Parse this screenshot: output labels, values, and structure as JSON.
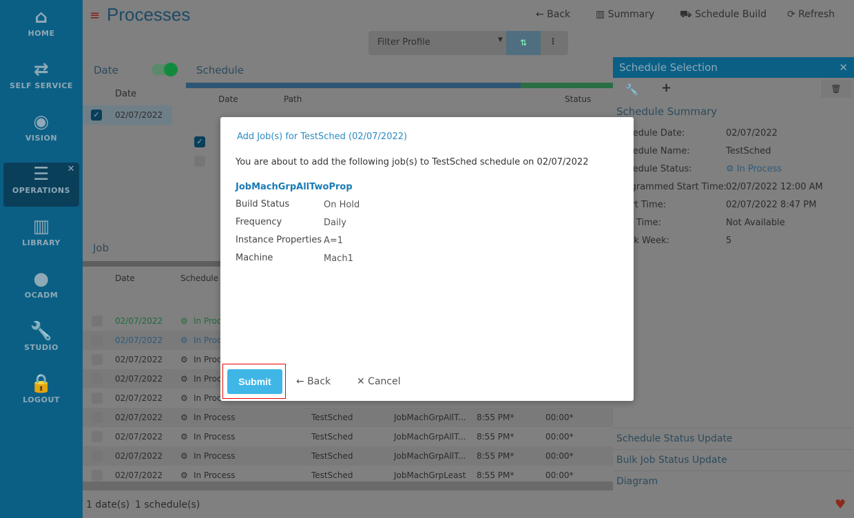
{
  "sidebar": {
    "items": [
      {
        "label": "HOME",
        "icon": "home-icon",
        "glyph": "⌂"
      },
      {
        "label": "SELF SERVICE",
        "icon": "exchange-icon",
        "glyph": "⇄"
      },
      {
        "label": "VISION",
        "icon": "eye-icon",
        "glyph": "◉"
      },
      {
        "label": "OPERATIONS",
        "icon": "tasks-icon",
        "glyph": "☰",
        "active": true
      },
      {
        "label": "LIBRARY",
        "icon": "books-icon",
        "glyph": "▥"
      },
      {
        "label": "OCADM",
        "icon": "user-icon",
        "glyph": "●"
      },
      {
        "label": "STUDIO",
        "icon": "wrench-icon",
        "glyph": "🔧"
      },
      {
        "label": "LOGOUT",
        "icon": "lock-icon",
        "glyph": "🔒"
      }
    ]
  },
  "header": {
    "title": "Processes",
    "back": "← Back",
    "summary": "▥ Summary",
    "schedule_build": "⛟ Schedule Build",
    "refresh": "⟳ Refresh"
  },
  "filter": {
    "placeholder": "Filter Profile"
  },
  "date_pane": {
    "title": "Date",
    "col": "Date",
    "rows": [
      "02/07/2022"
    ]
  },
  "schedule_pane": {
    "title": "Schedule",
    "cols": [
      "Date",
      "Path",
      "Status"
    ]
  },
  "job_pane": {
    "title": "Job",
    "cols": [
      "Date",
      "Schedule S"
    ],
    "rows": [
      {
        "date": "02/07/2022",
        "status": "In Proc",
        "sched": "",
        "job": "",
        "start": "",
        "dur": ""
      },
      {
        "date": "02/07/2022",
        "status": "In Proc",
        "sched": "",
        "job": "",
        "start": "",
        "dur": ""
      },
      {
        "date": "02/07/2022",
        "status": "In Proc",
        "sched": "",
        "job": "",
        "start": "",
        "dur": ""
      },
      {
        "date": "02/07/2022",
        "status": "In Proc",
        "sched": "",
        "job": "",
        "start": "",
        "dur": ""
      },
      {
        "date": "02/07/2022",
        "status": "In Proc",
        "sched": "",
        "job": "",
        "start": "",
        "dur": ""
      },
      {
        "date": "02/07/2022",
        "status": "In Process",
        "sched": "TestSched",
        "job": "JobMachGrpAllT...",
        "start": "8:55 PM*",
        "dur": "00:00*"
      },
      {
        "date": "02/07/2022",
        "status": "In Process",
        "sched": "TestSched",
        "job": "JobMachGrpAllT...",
        "start": "8:55 PM*",
        "dur": "00:00*"
      },
      {
        "date": "02/07/2022",
        "status": "In Process",
        "sched": "TestSched",
        "job": "JobMachGrpAllT...",
        "start": "8:55 PM*",
        "dur": "00:00*"
      },
      {
        "date": "02/07/2022",
        "status": "In Process",
        "sched": "TestSched",
        "job": "JobMachGrpLeast",
        "start": "8:55 PM*",
        "dur": "00:00*"
      }
    ]
  },
  "footer": {
    "dates": "1 date(s)",
    "schedules": "1 schedule(s)"
  },
  "right_panel": {
    "title": "Schedule Selection",
    "summary_title": "Schedule Summary",
    "fields": [
      {
        "label": "Schedule Date:",
        "value": "02/07/2022"
      },
      {
        "label": "Schedule Name:",
        "value": "TestSched"
      },
      {
        "label": "Schedule Status:",
        "value": "In Process"
      },
      {
        "label": "Programmed Start Time:",
        "value": "02/07/2022 12:00 AM"
      },
      {
        "label": "Start Time:",
        "value": "02/07/2022 8:47 PM"
      },
      {
        "label": "End Time:",
        "value": "Not Available"
      },
      {
        "label": "Work Week:",
        "value": "5"
      }
    ],
    "sections": [
      "Schedule Status Update",
      "Bulk Job Status Update",
      "Diagram"
    ]
  },
  "modal": {
    "title": "Add Job(s) for TestSched (02/07/2022)",
    "description": "You are about to add the following job(s) to TestSched schedule on 02/07/2022",
    "job": "JobMachGrpAllTwoProp",
    "props": [
      {
        "label": "Build Status",
        "value": "On Hold"
      },
      {
        "label": "Frequency",
        "value": "Daily"
      },
      {
        "label": "Instance Properties",
        "value": "A=1"
      },
      {
        "label": "Machine",
        "value": "Mach1"
      }
    ],
    "submit": "Submit",
    "back": "← Back",
    "cancel": "✕ Cancel"
  }
}
